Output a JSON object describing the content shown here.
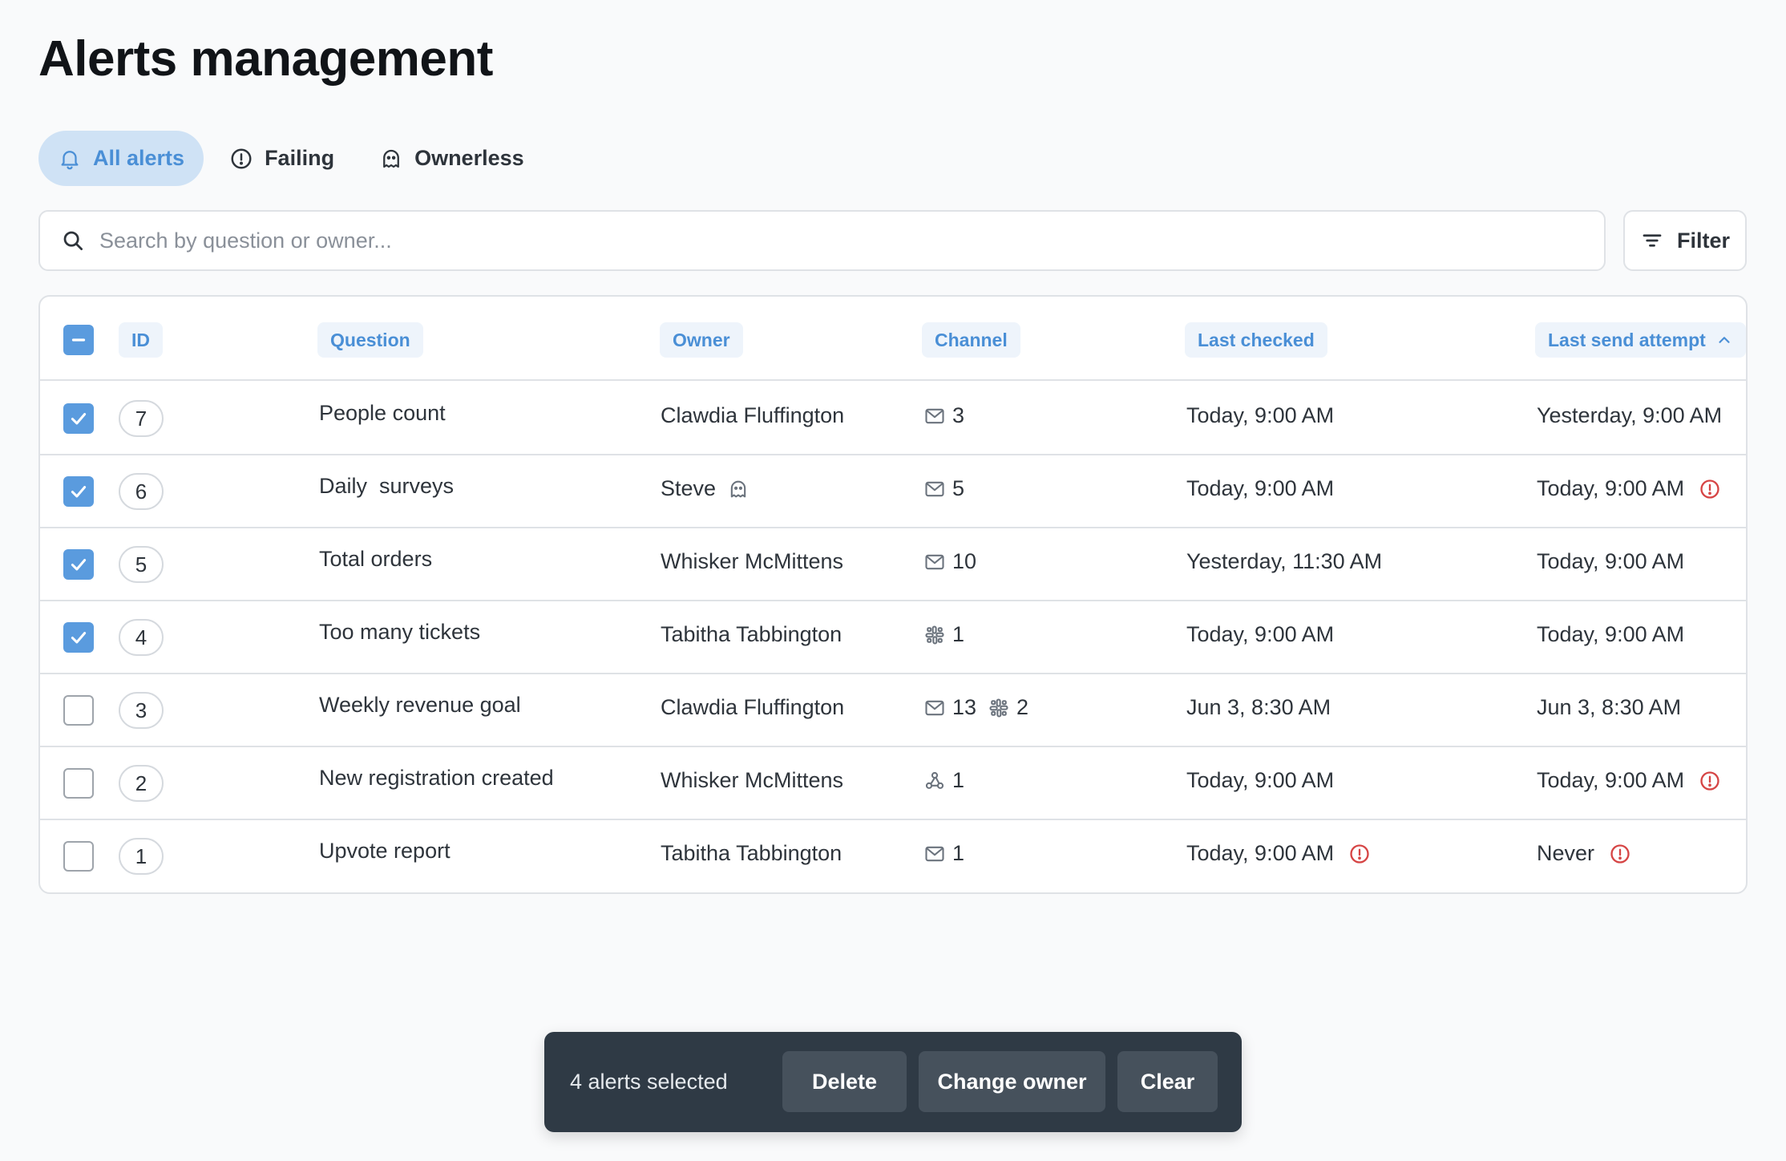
{
  "page": {
    "title": "Alerts management"
  },
  "tabs": [
    {
      "label": "All alerts",
      "icon": "bell-icon",
      "active": true
    },
    {
      "label": "Failing",
      "icon": "alert-circle-icon",
      "active": false
    },
    {
      "label": "Ownerless",
      "icon": "ghost-icon",
      "active": false
    }
  ],
  "search": {
    "placeholder": "Search by question or owner...",
    "value": ""
  },
  "filter": {
    "label": "Filter"
  },
  "table": {
    "columns": {
      "id": "ID",
      "question": "Question",
      "owner": "Owner",
      "channel": "Channel",
      "last_checked": "Last checked",
      "last_send_attempt": "Last send attempt"
    },
    "sort": {
      "column": "last_send_attempt",
      "direction": "ascending"
    },
    "select_all_state": "indeterminate",
    "rows": [
      {
        "checked": true,
        "id": "7",
        "question": "People count",
        "owner": "Clawdia Fluffington",
        "owner_ghost": false,
        "channels": [
          {
            "icon": "mail-icon",
            "count": "3"
          }
        ],
        "last_checked": "Today, 9:00 AM",
        "last_checked_warning": false,
        "last_send_attempt": "Yesterday, 9:00 AM",
        "last_send_warning": false
      },
      {
        "checked": true,
        "id": "6",
        "question": "Daily  surveys",
        "owner": "Steve",
        "owner_ghost": true,
        "channels": [
          {
            "icon": "mail-icon",
            "count": "5"
          }
        ],
        "last_checked": "Today, 9:00 AM",
        "last_checked_warning": false,
        "last_send_attempt": "Today, 9:00 AM",
        "last_send_warning": true
      },
      {
        "checked": true,
        "id": "5",
        "question": "Total orders",
        "owner": "Whisker McMittens",
        "owner_ghost": false,
        "channels": [
          {
            "icon": "mail-icon",
            "count": "10"
          }
        ],
        "last_checked": "Yesterday, 11:30 AM",
        "last_checked_warning": false,
        "last_send_attempt": "Today, 9:00 AM",
        "last_send_warning": false
      },
      {
        "checked": true,
        "id": "4",
        "question": "Too many tickets",
        "owner": "Tabitha Tabbington",
        "owner_ghost": false,
        "channels": [
          {
            "icon": "slack-icon",
            "count": "1"
          }
        ],
        "last_checked": "Today, 9:00 AM",
        "last_checked_warning": false,
        "last_send_attempt": "Today, 9:00 AM",
        "last_send_warning": false
      },
      {
        "checked": false,
        "id": "3",
        "question": "Weekly revenue goal",
        "owner": "Clawdia Fluffington",
        "owner_ghost": false,
        "channels": [
          {
            "icon": "mail-icon",
            "count": "13"
          },
          {
            "icon": "slack-icon",
            "count": "2"
          }
        ],
        "last_checked": "Jun 3, 8:30 AM",
        "last_checked_warning": false,
        "last_send_attempt": "Jun 3, 8:30 AM",
        "last_send_warning": false
      },
      {
        "checked": false,
        "id": "2",
        "question": "New registration created",
        "owner": "Whisker McMittens",
        "owner_ghost": false,
        "channels": [
          {
            "icon": "webhook-icon",
            "count": "1"
          }
        ],
        "last_checked": "Today, 9:00 AM",
        "last_checked_warning": false,
        "last_send_attempt": "Today, 9:00 AM",
        "last_send_warning": true
      },
      {
        "checked": false,
        "id": "1",
        "question": "Upvote report",
        "owner": "Tabitha Tabbington",
        "owner_ghost": false,
        "channels": [
          {
            "icon": "mail-icon",
            "count": "1"
          }
        ],
        "last_checked": "Today, 9:00 AM",
        "last_checked_warning": true,
        "last_send_attempt": "Never",
        "last_send_warning": true
      }
    ]
  },
  "bulk": {
    "selected_text": "4 alerts selected",
    "delete_label": "Delete",
    "change_owner_label": "Change owner",
    "clear_label": "Clear"
  },
  "colors": {
    "accent": "#4a8fd6",
    "checkbox": "#5a9bde",
    "warning": "#d64545",
    "bulk_bar": "#2f3a45"
  }
}
